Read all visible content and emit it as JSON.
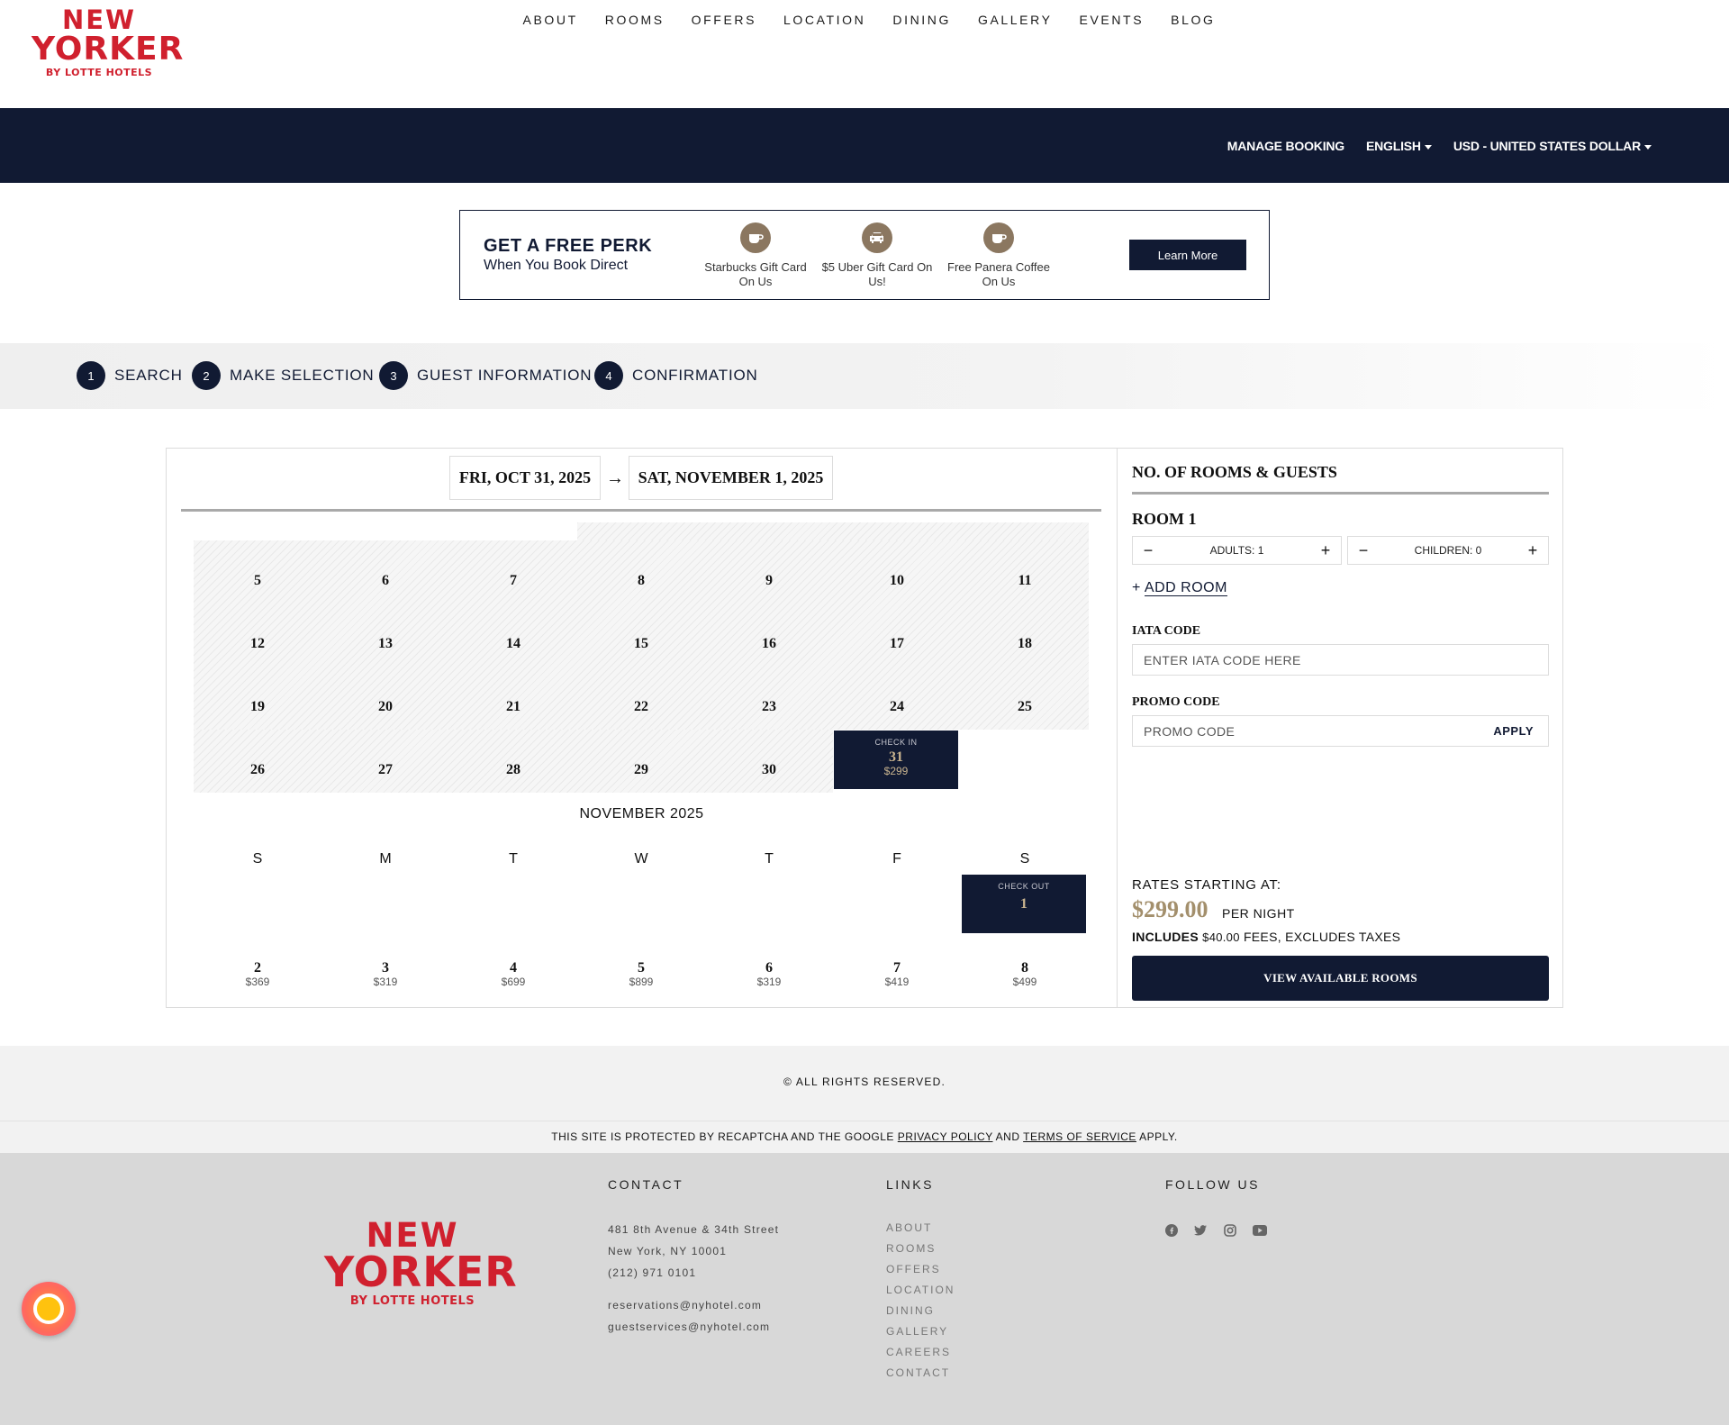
{
  "brand": {
    "line1": "NEW",
    "line2": "YORKER",
    "line3": "BY LOTTE HOTELS"
  },
  "nav": [
    "ABOUT",
    "ROOMS",
    "OFFERS",
    "LOCATION",
    "DINING",
    "GALLERY",
    "EVENTS",
    "BLOG"
  ],
  "topbar": {
    "manage": "MANAGE BOOKING",
    "language": "ENGLISH",
    "currency": "USD - UNITED STATES DOLLAR"
  },
  "perk": {
    "title": "GET A FREE PERK",
    "subtitle": "When You Book Direct",
    "items": [
      {
        "icon": "coffee-cup-icon",
        "label": "Starbucks Gift Card On Us"
      },
      {
        "icon": "car-icon",
        "label": "$5 Uber Gift Card On Us!"
      },
      {
        "icon": "coffee-cup-icon",
        "label": "Free Panera Coffee On Us"
      }
    ],
    "button": "Learn More"
  },
  "steps": [
    {
      "num": "1",
      "label": "SEARCH"
    },
    {
      "num": "2",
      "label": "MAKE SELECTION"
    },
    {
      "num": "3",
      "label": "GUEST INFORMATION"
    },
    {
      "num": "4",
      "label": "CONFIRMATION"
    }
  ],
  "dates": {
    "checkin": "FRI, OCT 31, 2025",
    "checkout": "SAT, NOVEMBER 1, 2025",
    "arrow": "→"
  },
  "october": {
    "rows": [
      [
        "5",
        "6",
        "7",
        "8",
        "9",
        "10",
        "11"
      ],
      [
        "12",
        "13",
        "14",
        "15",
        "16",
        "17",
        "18"
      ],
      [
        "19",
        "20",
        "21",
        "22",
        "23",
        "24",
        "25"
      ],
      [
        "26",
        "27",
        "28",
        "29",
        "30"
      ]
    ],
    "checkin_cell": {
      "caption": "CHECK IN",
      "day": "31",
      "price": "$299"
    }
  },
  "november": {
    "title": "NOVEMBER 2025",
    "weekdays": [
      "S",
      "M",
      "T",
      "W",
      "T",
      "F",
      "S"
    ],
    "checkout_cell": {
      "caption": "CHECK OUT",
      "day": "1"
    },
    "row": [
      {
        "day": "2",
        "price": "$369"
      },
      {
        "day": "3",
        "price": "$319"
      },
      {
        "day": "4",
        "price": "$699"
      },
      {
        "day": "5",
        "price": "$899"
      },
      {
        "day": "6",
        "price": "$319"
      },
      {
        "day": "7",
        "price": "$419"
      },
      {
        "day": "8",
        "price": "$499"
      }
    ]
  },
  "guests": {
    "title": "NO. OF ROOMS & GUESTS",
    "room": "ROOM 1",
    "adults": "ADULTS: 1",
    "children": "CHILDREN: 0",
    "minus": "−",
    "plus": "+",
    "add_room": "ADD ROOM",
    "iata_label": "IATA CODE",
    "iata_placeholder": "ENTER IATA CODE HERE",
    "promo_label": "PROMO CODE",
    "promo_placeholder": "PROMO CODE",
    "apply": "APPLY"
  },
  "rates": {
    "label": "RATES STARTING AT:",
    "amount": "$299.00",
    "per_night": "PER NIGHT",
    "includes": "INCLUDES",
    "fee": "$40.00",
    "fees_text": "FEES, EXCLUDES TAXES",
    "button": "VIEW AVAILABLE ROOMS"
  },
  "footer": {
    "rights": "© ALL RIGHTS RESERVED.",
    "recaptcha_pre": "THIS SITE IS PROTECTED BY RECAPTCHA AND THE GOOGLE",
    "privacy": "PRIVACY POLICY",
    "and": "AND",
    "terms": "TERMS OF SERVICE",
    "apply": "APPLY.",
    "contact_h": "CONTACT",
    "address1": "481 8th Avenue & 34th Street",
    "address2": "New York, NY 10001",
    "phone": "(212) 971 0101",
    "email1": "reservations@nyhotel.com",
    "email2": "guestservices@nyhotel.com",
    "links_h": "LINKS",
    "links": [
      "ABOUT",
      "ROOMS",
      "OFFERS",
      "LOCATION",
      "DINING",
      "GALLERY",
      "CAREERS",
      "CONTACT"
    ],
    "follow_h": "FOLLOW US",
    "social": [
      "facebook-icon",
      "twitter-icon",
      "instagram-icon",
      "youtube-icon"
    ]
  }
}
